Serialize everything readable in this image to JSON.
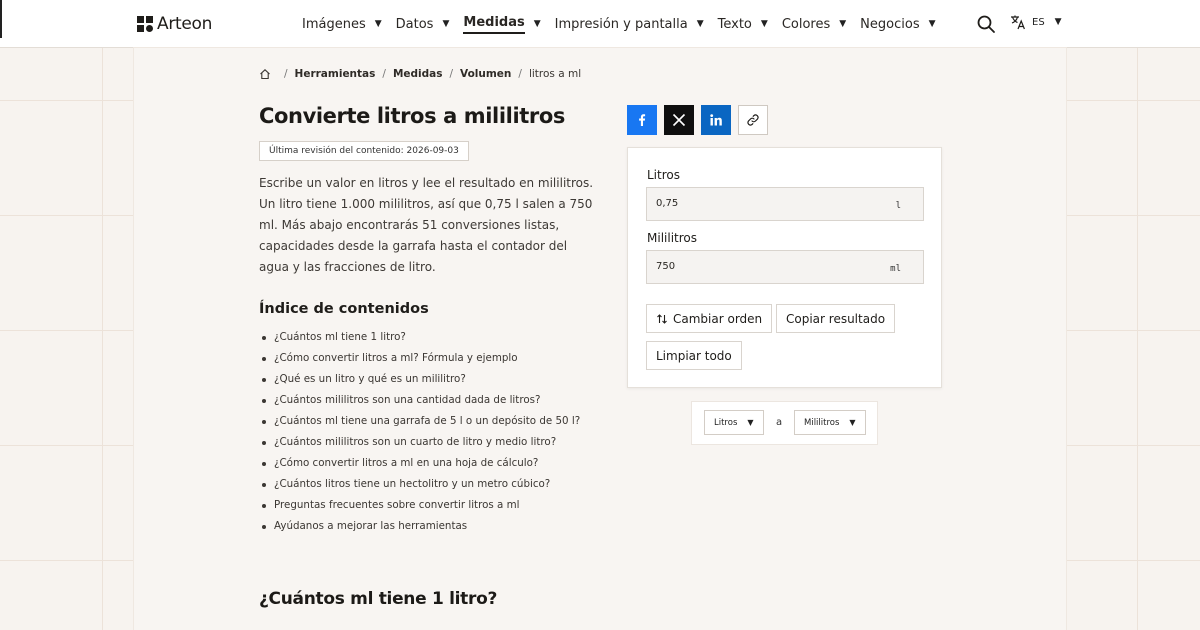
{
  "brand": {
    "name": "Arteon"
  },
  "nav": {
    "items": [
      {
        "label": "Imágenes"
      },
      {
        "label": "Datos"
      },
      {
        "label": "Medidas"
      },
      {
        "label": "Impresión y pantalla"
      },
      {
        "label": "Texto"
      },
      {
        "label": "Colores"
      },
      {
        "label": "Negocios"
      }
    ],
    "active": "Medidas",
    "language": "ES"
  },
  "breadcrumb": {
    "items": [
      "Herramientas",
      "Medidas",
      "Volumen"
    ],
    "current": "litros a ml"
  },
  "page": {
    "title": "Convierte litros a mililitros",
    "revision": "Última revisión del contenido: 2026-09-03",
    "intro": "Escribe un valor en litros y lee el resultado en mililitros. Un litro tiene 1.000 mililitros, así que 0,75 l salen a 750 ml. Más abajo encontrarás 51 conversiones listas, capacidades desde la garrafa hasta el contador del agua y las fracciones de litro."
  },
  "toc": {
    "title": "Índice de contenidos",
    "items": [
      "¿Cuántos ml tiene 1 litro?",
      "¿Cómo convertir litros a ml? Fórmula y ejemplo",
      "¿Qué es un litro y qué es un mililitro?",
      "¿Cuántos mililitros son una cantidad dada de litros?",
      "¿Cuántos ml tiene una garrafa de 5 l o un depósito de 50 l?",
      "¿Cuántos mililitros son un cuarto de litro y medio litro?",
      "¿Cómo convertir litros a ml en una hoja de cálculo?",
      "¿Cuántos litros tiene un hectolitro y un metro cúbico?",
      "Preguntas frecuentes sobre convertir litros a ml",
      "Ayúdanos a mejorar las herramientas"
    ]
  },
  "section": {
    "title": "¿Cuántos ml tiene 1 litro?"
  },
  "share": {
    "icons": [
      "facebook-icon",
      "x-icon",
      "linkedin-icon",
      "link-icon"
    ]
  },
  "converter": {
    "from": {
      "label": "Litros",
      "value": "0,75",
      "unit": "l"
    },
    "to": {
      "label": "Mililitros",
      "value": "750",
      "unit": "ml"
    },
    "buttons": {
      "swap": "Cambiar orden",
      "copy": "Copiar resultado",
      "clear": "Limpiar todo"
    }
  },
  "unit_selector": {
    "from": "Litros",
    "connector": "a",
    "to": "Mililitros"
  },
  "colors": {
    "facebook": "#1877f2",
    "x": "#0f0f0f",
    "linkedin": "#0a66c2",
    "page_bg": "#f7f3ef"
  }
}
